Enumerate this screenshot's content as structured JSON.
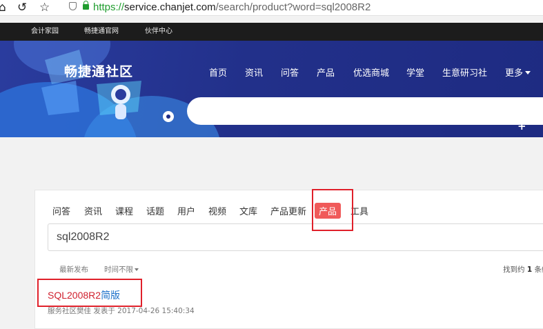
{
  "browser": {
    "url_scheme": "https://",
    "url_host": "service.chanjet.com",
    "url_path": "/search/product?word=sql2008R2"
  },
  "top_links": [
    "会计家园",
    "畅捷通官网",
    "伙伴中心"
  ],
  "site": {
    "logo": "畅捷通社区",
    "nav": [
      "首页",
      "资讯",
      "问答",
      "产品",
      "优选商城",
      "学堂",
      "生意研习社",
      "更多"
    ]
  },
  "search_tabs": [
    "问答",
    "资讯",
    "课程",
    "话题",
    "用户",
    "视频",
    "文库",
    "产品更新",
    "产品",
    "工具"
  ],
  "active_tab": "产品",
  "query": "sql2008R2",
  "sort": {
    "latest": "最新发布",
    "time": "时间不限"
  },
  "results_summary": {
    "prefix": "找到约",
    "count": "1",
    "suffix": "条结"
  },
  "result": {
    "title_match": "SQL2008R2",
    "title_rest": "简版",
    "meta": "服务社区樊佳 发表于 2017-04-26 15:40:34"
  },
  "colors": {
    "banner": "#22308a",
    "accent_tab": "#f05a5a",
    "highlight": "#d0202e",
    "link": "#1a6fc9",
    "annotation": "#e0202a"
  }
}
